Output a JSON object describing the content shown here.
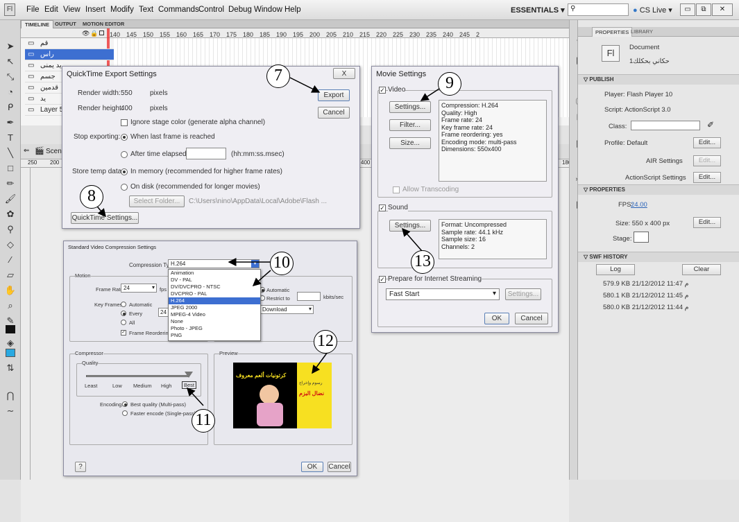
{
  "menubar": {
    "logo": "Fl",
    "items": [
      "File",
      "Edit",
      "View",
      "Insert",
      "Modify",
      "Text",
      "Commands",
      "Control",
      "Debug",
      "Window",
      "Help"
    ],
    "workspace": "ESSENTIALS ▾",
    "cslive": "CS Live"
  },
  "panel_tabs": [
    "TIMELINE",
    "OUTPUT",
    "MOTION EDITOR"
  ],
  "timeline": {
    "frame_numbers": [
      "140",
      "145",
      "150",
      "155",
      "160",
      "165",
      "170",
      "175",
      "180",
      "185",
      "190",
      "195",
      "200",
      "205",
      "210",
      "215",
      "220",
      "225",
      "230",
      "235",
      "240",
      "245",
      "2"
    ],
    "layers": [
      "قم",
      "راس",
      "يد يمنى",
      "جسم",
      "قدمين",
      "يد",
      "Layer 5"
    ],
    "scene": "Scene",
    "hruler": [
      "250",
      "200",
      "400",
      "180"
    ]
  },
  "quicktime": {
    "title": "QuickTime Export Settings",
    "render_width_label": "Render width:",
    "render_width_value": "550",
    "render_height_label": "Render height:",
    "render_height_value": "400",
    "pixels": "pixels",
    "ignore_stage": "Ignore stage color (generate alpha channel)",
    "stop_label": "Stop exporting:",
    "stop_opt1": "When last frame is reached",
    "stop_opt2": "After time elapsed:",
    "time_hint": "(hh:mm:ss.msec)",
    "store_label": "Store temp data:",
    "store_opt1": "In memory (recommended for higher frame rates)",
    "store_opt2": "On disk (recommended for longer movies)",
    "select_folder": "Select Folder...",
    "path": "C:\\Users\\nino\\AppData\\Local\\Adobe\\Flash ...",
    "qt_settings": "QuickTime Settings...",
    "export": "Export",
    "cancel": "Cancel",
    "close": "X"
  },
  "movie": {
    "title": "Movie Settings",
    "video": "Video",
    "settings": "Settings...",
    "filter": "Filter...",
    "size": "Size...",
    "video_info": [
      "Compression: H.264",
      "Quality: High",
      "Frame rate: 24",
      "Key frame rate: 24",
      "Frame reordering: yes",
      "Encoding mode: multi-pass",
      "Dimensions: 550x400"
    ],
    "allow_transcoding": "Allow Transcoding",
    "sound": "Sound",
    "sound_info": [
      "Format: Uncompressed",
      "Sample rate: 44.1 kHz",
      "Sample size: 16",
      "Channels: 2"
    ],
    "prepare": "Prepare for Internet Streaming",
    "fast_start": "Fast Start",
    "settings_disabled": "Settings...",
    "ok": "OK",
    "cancel": "Cancel"
  },
  "compression": {
    "title": "Standard Video Compression Settings",
    "type_label": "Compression Type:",
    "type_value": "H.264",
    "options": [
      "Animation",
      "DV - PAL",
      "DV/DVCPRO - NTSC",
      "DVCPRO - PAL",
      "H.264",
      "JPEG 2000",
      "MPEG-4 Video",
      "None",
      "Photo - JPEG",
      "PNG"
    ],
    "selected_index": 4,
    "motion": "Motion",
    "frame_rate_label": "Frame Rate:",
    "frame_rate_value": "24",
    "fps": "fps",
    "key_frames": "Key Frames:",
    "kf_automatic": "Automatic",
    "kf_every": "Every",
    "kf_every_value": "24",
    "kf_all": "All",
    "frame_reordering": "Frame Reordering",
    "automatic": "Automatic",
    "restrict": "Restrict to",
    "kbits": "kbits/sec",
    "download": "Download",
    "compressor": "Compressor",
    "quality": "Quality",
    "q_least": "Least",
    "q_low": "Low",
    "q_medium": "Medium",
    "q_high": "High",
    "q_best": "Best",
    "quality_level": 1.0,
    "encoding_label": "Encoding:",
    "enc1": "Best quality (Multi-pass)",
    "enc2": "Faster encode (Single-pass)",
    "preview": "Preview",
    "preview_banner": "كرتونيات ألعم معروف",
    "preview_side1": "رسوم وإخراج",
    "preview_side2": "نضال البزم",
    "help": "?",
    "ok": "OK",
    "cancel": "Cancel"
  },
  "annotations": [
    "7",
    "8",
    "9",
    "10",
    "11",
    "12",
    "13"
  ],
  "properties": {
    "tabs": [
      "PROPERTIES",
      "LIBRARY"
    ],
    "doc_icon": "Fl",
    "doc_label": "Document",
    "doc_name": "حكاني بحكلك1",
    "publish": "PUBLISH",
    "player": "Player:  Flash Player 10",
    "script": "Script:  ActionScript 3.0",
    "class": "Class:",
    "profile": "Profile:  Default",
    "edit": "Edit...",
    "air": "AIR Settings",
    "as_settings": "ActionScript Settings",
    "properties": "PROPERTIES",
    "fps_label": "FPS:",
    "fps_value": "24.00",
    "size": "Size:  550 x 400 px",
    "stage": "Stage:",
    "history": "SWF HISTORY",
    "log": "Log",
    "clear": "Clear",
    "history_rows": [
      "579.9 KB  21/12/2012   11:47 م",
      "580.1 KB  21/12/2012   11:45 م",
      "580.0 KB  21/12/2012   11:44 م"
    ]
  },
  "colors": {
    "accent": "#3478c8",
    "selection": "#3d6fd1",
    "preview_yellow": "#f7e021"
  }
}
